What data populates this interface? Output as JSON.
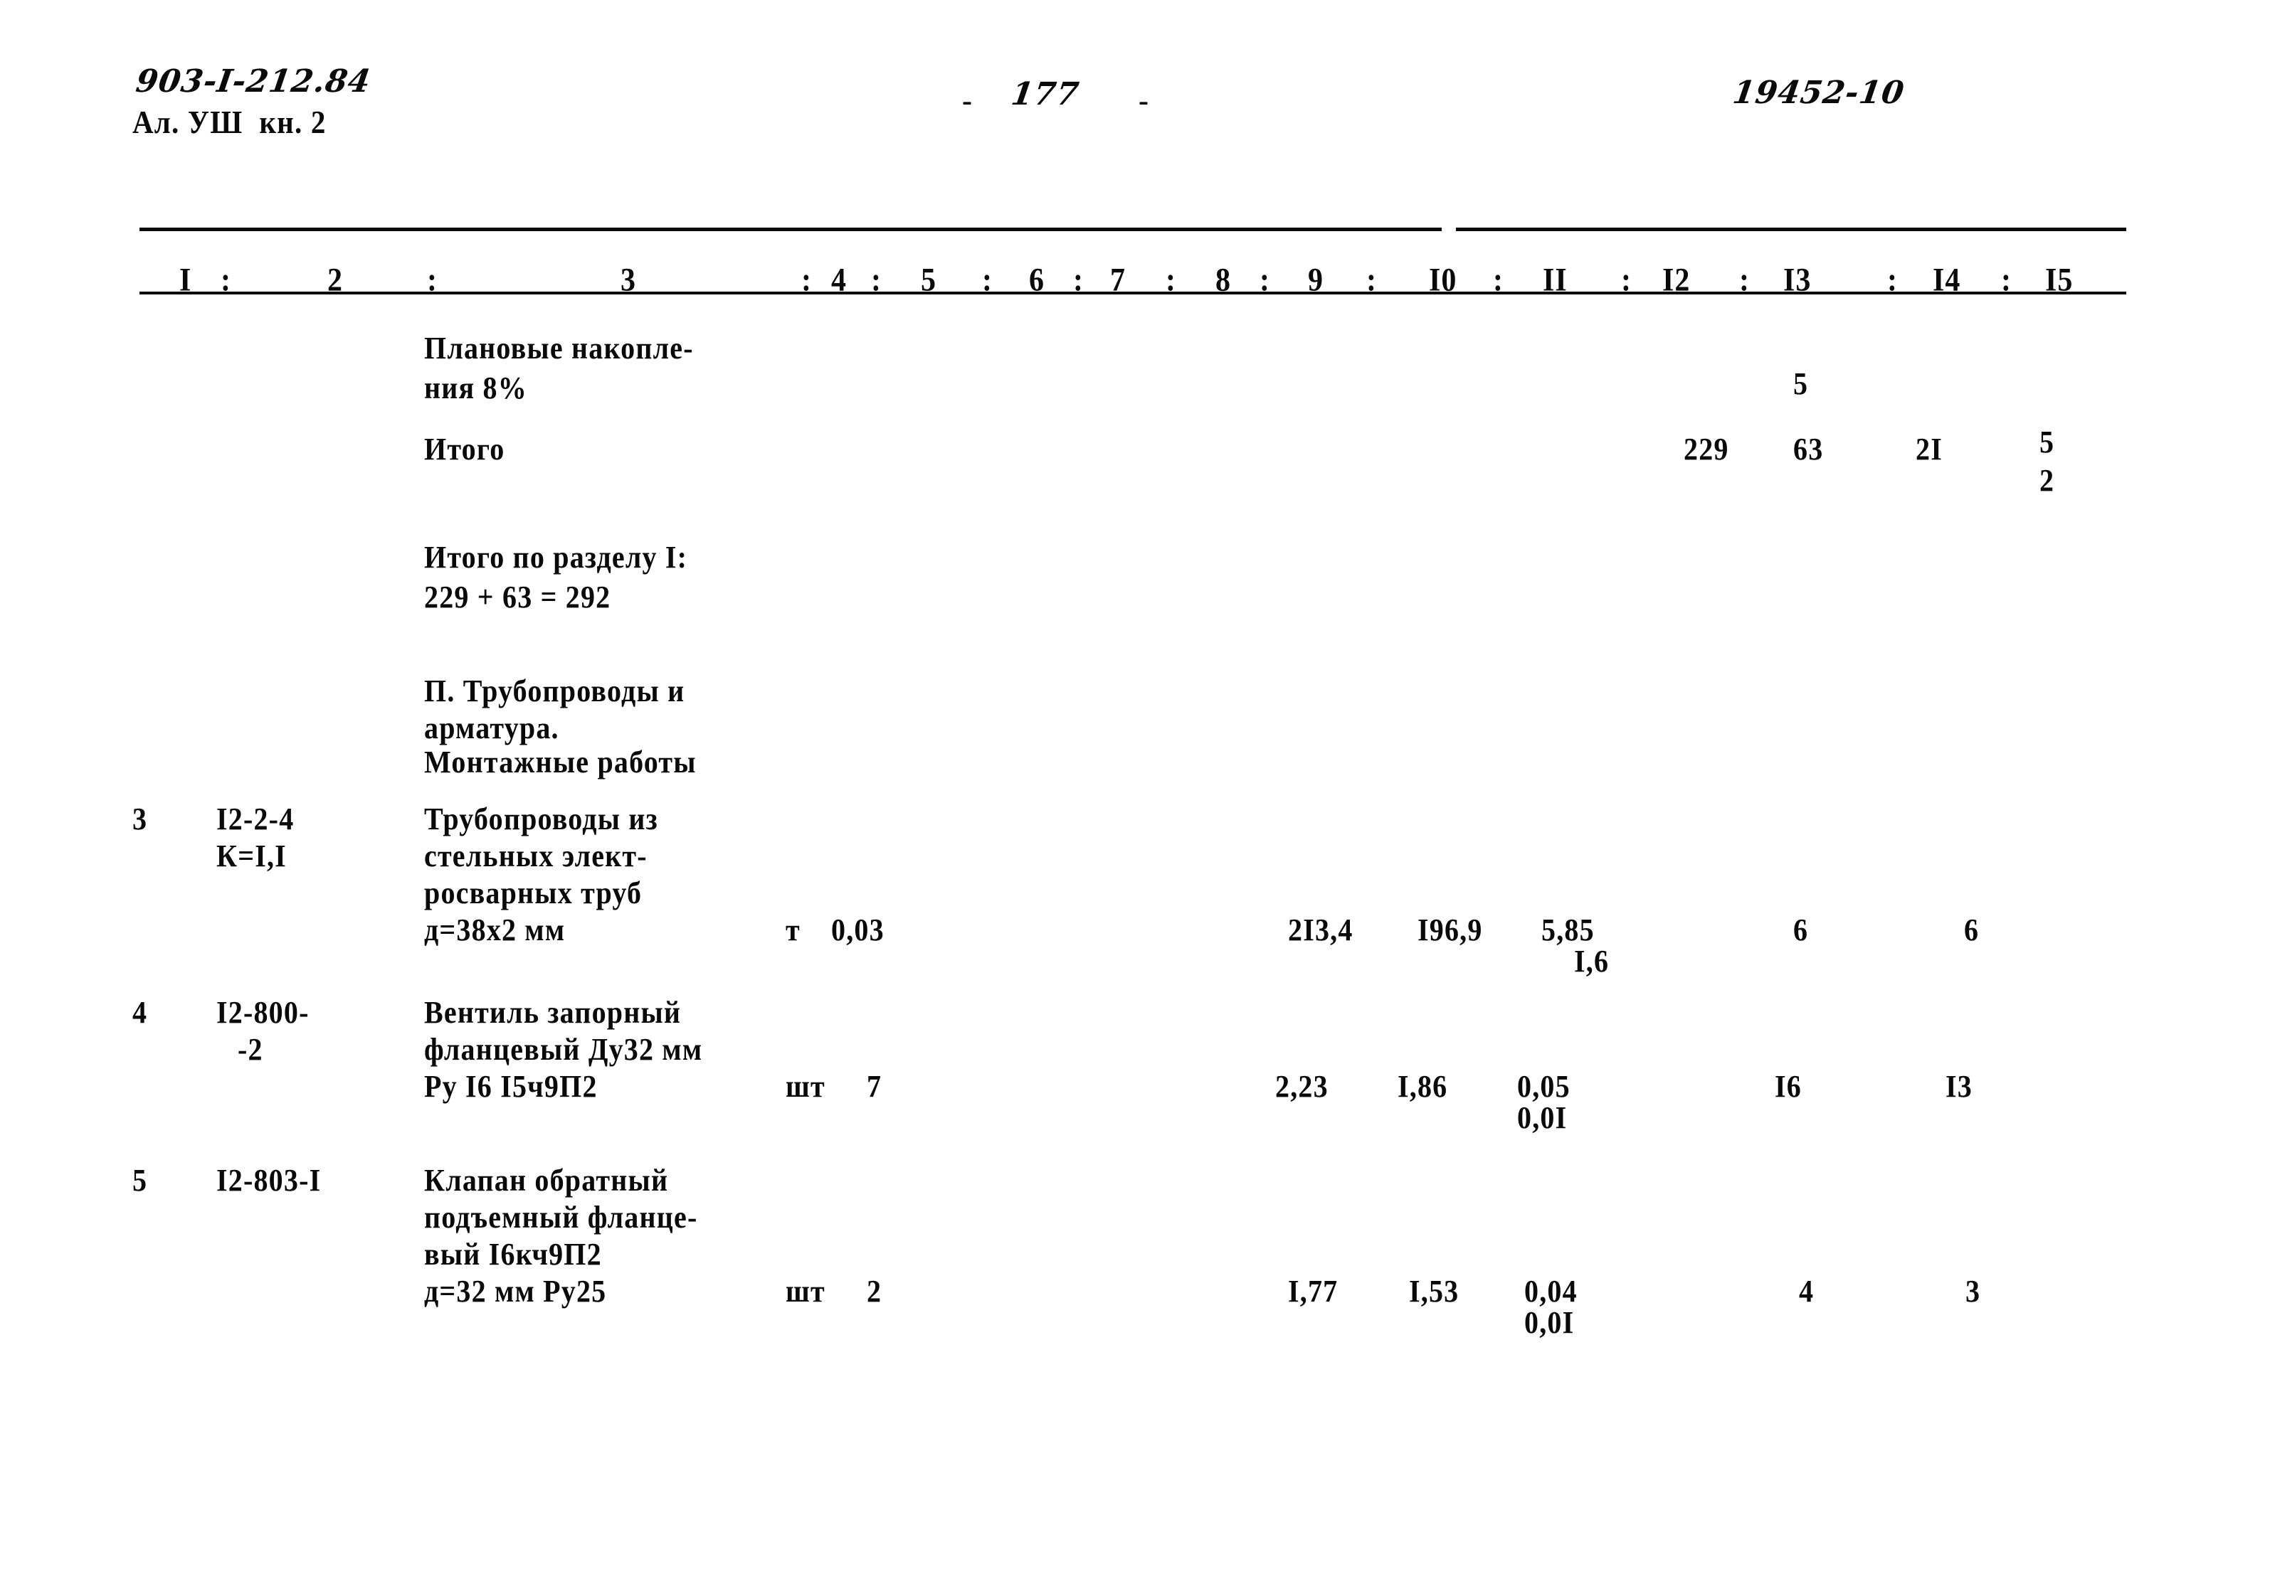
{
  "header": {
    "album_code": "903-I-212.84",
    "album_line2": "Ал. УШ  кн. 2",
    "page_number": "177",
    "page_dash_left": "-",
    "page_dash_right": "-",
    "doc_number": "19452-10"
  },
  "table": {
    "column_headers": [
      "I",
      "2",
      "3",
      "4",
      "5",
      "6",
      "7",
      "8",
      "9",
      "I0",
      "II",
      "I2",
      "I3",
      "I4",
      "I5"
    ],
    "separator": ":",
    "rows": [
      {
        "kind": "summary",
        "name": "planovye-nakopleniya",
        "desc_lines": [
          "Плановые накопле-",
          "ния 8%"
        ],
        "percent_marker": "8%",
        "col12": "",
        "col13": "5",
        "col14": "",
        "col15": ""
      },
      {
        "kind": "summary",
        "name": "itogo",
        "desc_lines": [
          "Итого"
        ],
        "col12": "229",
        "col13": "63",
        "col14": "2I",
        "col15_top": "5",
        "col15_bottom": "2"
      },
      {
        "kind": "section-total",
        "name": "itogo-po-razdelu",
        "desc_lines": [
          "Итого по разделу I:",
          "229 + 63 = 292"
        ]
      },
      {
        "kind": "section-heading",
        "name": "razdel-2-heading",
        "desc_lines": [
          "П. Трубопроводы и",
          "арматура.",
          "Монтажные работы"
        ]
      },
      {
        "kind": "item",
        "name": "item-3-truboprovody",
        "no": "3",
        "code_lines": [
          "I2-2-4",
          "К=I,I"
        ],
        "desc_lines": [
          "Трубопроводы из",
          "стельных элект-",
          "росварных труб",
          "д=38х2 мм"
        ],
        "unit": "т",
        "qty": "0,03",
        "col8": "2I3,4",
        "col9": "I96,9",
        "col10_top": "5,85",
        "col10_bottom": "I,6",
        "col12": "6",
        "col13": "6"
      },
      {
        "kind": "item",
        "name": "item-4-ventil",
        "no": "4",
        "code_lines": [
          "I2-800-",
          "-2"
        ],
        "desc_lines": [
          "Вентиль запорный",
          "фланцевый Ду32 мм",
          "Ру I6 I5ч9П2"
        ],
        "unit": "шт",
        "qty": "7",
        "col8": "2,23",
        "col9": "I,86",
        "col10_top": "0,05",
        "col10_bottom": "0,0I",
        "col12": "I6",
        "col13": "I3"
      },
      {
        "kind": "item",
        "name": "item-5-klapan",
        "no": "5",
        "code_lines": [
          "I2-803-I"
        ],
        "desc_lines": [
          "Клапан обратный",
          "подъемный фланце-",
          "вый I6кч9П2",
          "д=32 мм Ру25"
        ],
        "unit": "шт",
        "qty": "2",
        "col8": "I,77",
        "col9": "I,53",
        "col10_top": "0,04",
        "col10_bottom": "0,0I",
        "col12": "4",
        "col13": "3"
      }
    ]
  }
}
